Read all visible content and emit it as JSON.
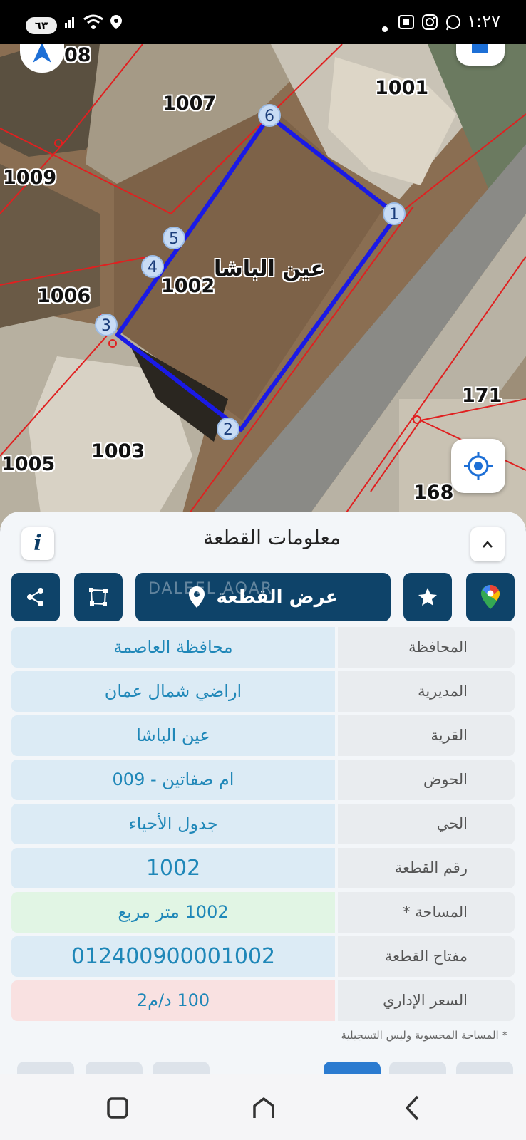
{
  "status_bar": {
    "time": "١:٢٧",
    "battery": "٦٣"
  },
  "map": {
    "village_label": "عين الباشا",
    "parcels": {
      "p1008": "08",
      "p1007": "1007",
      "p1001": "1001",
      "p1009": "1009",
      "p1002": "1002",
      "p1006": "1006",
      "p171": "171",
      "p1003": "1003",
      "p1005": "1005",
      "p168": "168"
    },
    "vertices": [
      "1",
      "2",
      "3",
      "4",
      "5",
      "6"
    ]
  },
  "panel": {
    "title": "معلومات القطعة",
    "info_label": "i",
    "view_parcel_label": "عرض القطعة",
    "watermark": "DALEEL AQAR",
    "rows": [
      {
        "key": "المحافظة",
        "value": "محافظة العاصمة"
      },
      {
        "key": "المديرية",
        "value": "اراضي شمال عمان"
      },
      {
        "key": "القرية",
        "value": "عين الباشا"
      },
      {
        "key": "الحوض",
        "value": "ام صفاتين - 009"
      },
      {
        "key": "الحي",
        "value": "جدول الأحياء"
      },
      {
        "key": "رقم القطعة",
        "value": "1002"
      },
      {
        "key": "المساحة *",
        "value": "1002   متر مربع"
      },
      {
        "key": "مفتاح القطعة",
        "value": "012400900001002"
      },
      {
        "key": "السعر الإداري",
        "value": "100 د/م2"
      }
    ],
    "footnote": "* المساحة المحسوبة وليس التسجيلية"
  },
  "colors": {
    "accent": "#0e4369",
    "value_text": "#1f87b8",
    "parcel_outline": "#1a1ae6",
    "boundary_lines": "#e02020"
  }
}
